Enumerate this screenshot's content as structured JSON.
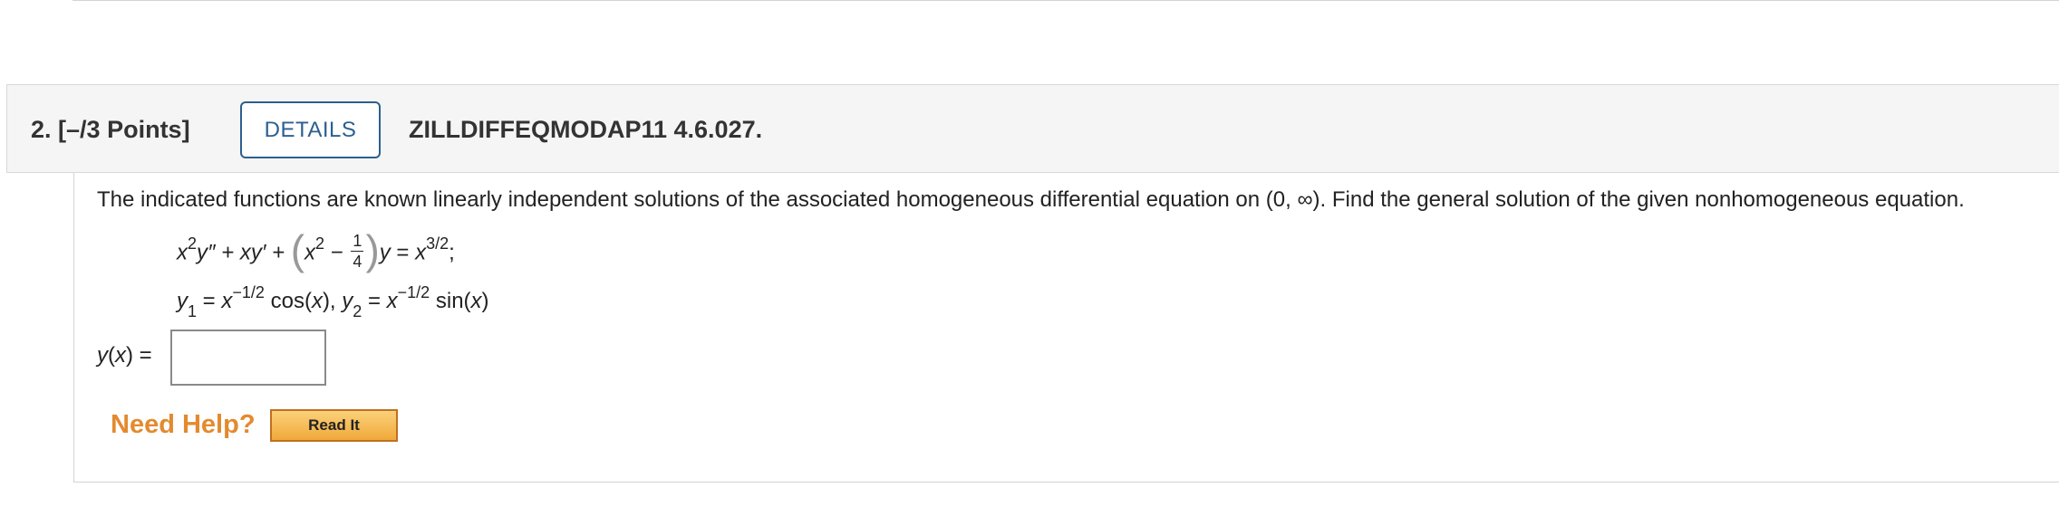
{
  "question": {
    "number": "2.",
    "points": "[–/3 Points]",
    "details_label": "DETAILS",
    "code": "ZILLDIFFEQMODAP11 4.6.027."
  },
  "prompt": "The indicated functions are known linearly independent solutions of the associated homogeneous differential equation on (0, ∞). Find the general solution of the given nonhomogeneous equation.",
  "equation": {
    "lhs_start": "x",
    "sup_2": "2",
    "y_dd": "y″ + xy′ + ",
    "paren_open": "(",
    "x": "x",
    "minus": " − ",
    "frac_num": "1",
    "frac_den": "4",
    "paren_close": ")",
    "y_eq": "y",
    "equals": " = ",
    "rhs_x": "x",
    "rhs_sup": "3/2",
    "semicolon": ";"
  },
  "solutions": {
    "y": "y",
    "sub1": "1",
    "eq1": " = ",
    "x1": "x",
    "sup1": "−1/2",
    "cos": " cos(",
    "cos_x": "x",
    "cos_close": "), ",
    "y2": "y",
    "sub2": "2",
    "eq2": " = ",
    "x2": "x",
    "sup2": "−1/2",
    "sin": " sin(",
    "sin_x": "x",
    "sin_close": ")"
  },
  "answer": {
    "label_y": "y",
    "label_paren_open": "(",
    "label_x": "x",
    "label_rest": ") =",
    "value": ""
  },
  "help": {
    "need_help": "Need Help?",
    "read_it": "Read It"
  }
}
